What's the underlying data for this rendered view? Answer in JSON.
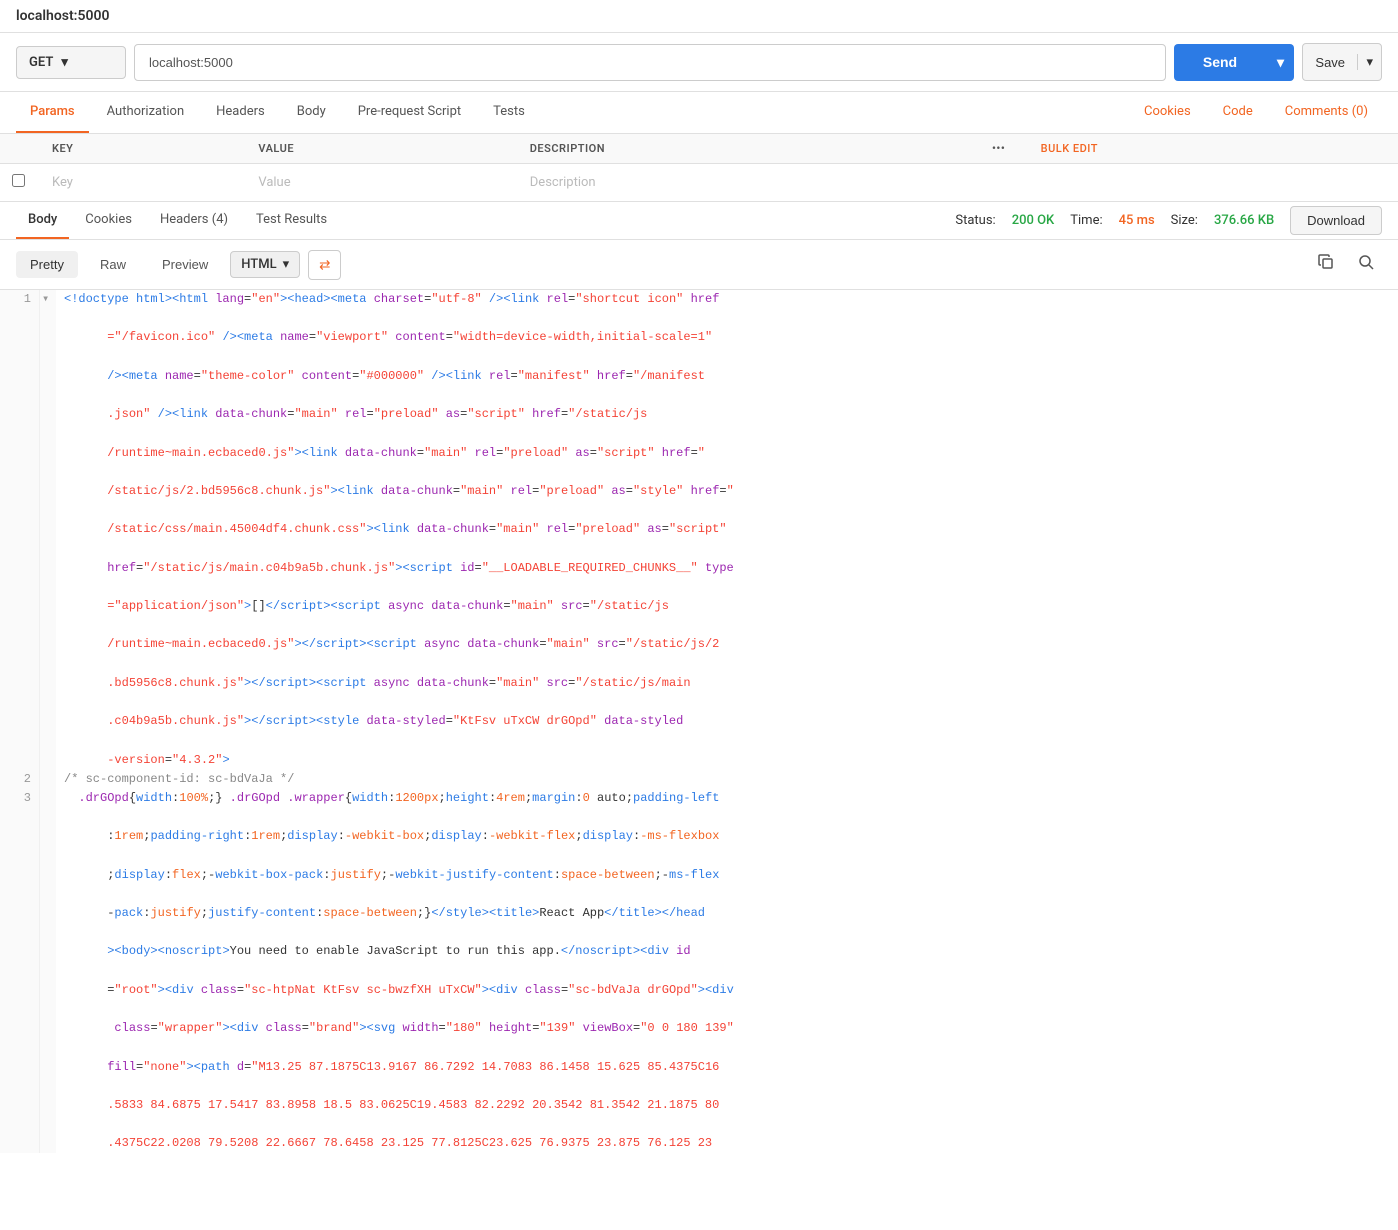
{
  "header": {
    "host": "localhost:5000"
  },
  "request": {
    "method": "GET",
    "url": "localhost:5000",
    "send_label": "Send",
    "save_label": "Save"
  },
  "request_tabs": [
    {
      "id": "params",
      "label": "Params",
      "active": true
    },
    {
      "id": "authorization",
      "label": "Authorization"
    },
    {
      "id": "headers",
      "label": "Headers"
    },
    {
      "id": "body",
      "label": "Body"
    },
    {
      "id": "pre-request-script",
      "label": "Pre-request Script"
    },
    {
      "id": "tests",
      "label": "Tests"
    },
    {
      "id": "cookies",
      "label": "Cookies",
      "style": "orange"
    },
    {
      "id": "code",
      "label": "Code",
      "style": "orange"
    },
    {
      "id": "comments",
      "label": "Comments (0)",
      "style": "orange"
    }
  ],
  "params_table": {
    "columns": [
      "KEY",
      "VALUE",
      "DESCRIPTION"
    ],
    "rows": [
      {
        "key": "Key",
        "value": "Value",
        "description": "Description"
      }
    ],
    "more_label": "...",
    "bulk_edit_label": "Bulk Edit"
  },
  "response_tabs": [
    {
      "id": "body",
      "label": "Body",
      "active": true
    },
    {
      "id": "cookies",
      "label": "Cookies"
    },
    {
      "id": "headers",
      "label": "Headers (4)"
    },
    {
      "id": "test-results",
      "label": "Test Results"
    }
  ],
  "response_status": {
    "status_label": "Status:",
    "status_value": "200 OK",
    "time_label": "Time:",
    "time_value": "45 ms",
    "size_label": "Size:",
    "size_value": "376.66 KB",
    "download_label": "Download"
  },
  "format_row": {
    "views": [
      "Pretty",
      "Raw",
      "Preview"
    ],
    "active_view": "Pretty",
    "format": "HTML",
    "wrap_icon": "≡→"
  },
  "code_content": {
    "lines": [
      {
        "num": "1",
        "arrow": "▾",
        "html": "<span class='c-tag'>&lt;!doctype html&gt;&lt;html </span><span class='c-attr'>lang</span><span class='c-txt'>=</span><span class='c-val'>\"en\"</span><span class='c-tag'>&gt;&lt;head&gt;&lt;meta </span><span class='c-attr'>charset</span><span class='c-txt'>=</span><span class='c-val'>\"utf-8\"</span><span class='c-tag'> /&gt;&lt;link </span><span class='c-attr'>rel</span><span class='c-txt'>=</span><span class='c-val'>\"shortcut icon\"</span><span class='c-attr'> href</span><br>&nbsp;&nbsp;&nbsp;&nbsp;&nbsp;&nbsp;&nbsp;<span class='c-val'>=\"/favicon.ico\"</span><span class='c-tag'> /&gt;&lt;meta </span><span class='c-attr'>name</span><span class='c-txt'>=</span><span class='c-val'>\"viewport\"</span><span class='c-attr'> content</span><span class='c-txt'>=</span><span class='c-val'>\"width=device-width,initial-scale=1\"</span><br>&nbsp;&nbsp;&nbsp;&nbsp;&nbsp;&nbsp;&nbsp;<span class='c-tag'>/&gt;&lt;meta </span><span class='c-attr'>name</span><span class='c-txt'>=</span><span class='c-val'>\"theme-color\"</span><span class='c-attr'> content</span><span class='c-txt'>=</span><span class='c-val'>\"#000000\"</span><span class='c-tag'> /&gt;&lt;link </span><span class='c-attr'>rel</span><span class='c-txt'>=</span><span class='c-val'>\"manifest\"</span><span class='c-attr'> href</span><span class='c-txt'>=</span><span class='c-val'>\"/manifest</span><br>&nbsp;&nbsp;&nbsp;&nbsp;&nbsp;&nbsp;&nbsp;<span class='c-val'>.json\"</span><span class='c-tag'> /&gt;&lt;link </span><span class='c-attr'>data-chunk</span><span class='c-txt'>=</span><span class='c-val'>\"main\"</span><span class='c-attr'> rel</span><span class='c-txt'>=</span><span class='c-val'>\"preload\"</span><span class='c-attr'> as</span><span class='c-txt'>=</span><span class='c-val'>\"script\"</span><span class='c-attr'> href</span><span class='c-txt'>=</span><span class='c-val'>\"/static/js</span><br>&nbsp;&nbsp;&nbsp;&nbsp;&nbsp;&nbsp;&nbsp;<span class='c-val'>/runtime~main.ecbaced0.js\"</span><span class='c-tag'>&gt;&lt;link </span><span class='c-attr'>data-chunk</span><span class='c-txt'>=</span><span class='c-val'>\"main\"</span><span class='c-attr'> rel</span><span class='c-txt'>=</span><span class='c-val'>\"preload\"</span><span class='c-attr'> as</span><span class='c-txt'>=</span><span class='c-val'>\"script\"</span><span class='c-attr'> href</span><span class='c-txt'>=</span><span class='c-val'>\"</span><br>&nbsp;&nbsp;&nbsp;&nbsp;&nbsp;&nbsp;&nbsp;<span class='c-val'>/static/js/2.bd5956c8.chunk.js\"</span><span class='c-tag'>&gt;&lt;link </span><span class='c-attr'>data-chunk</span><span class='c-txt'>=</span><span class='c-val'>\"main\"</span><span class='c-attr'> rel</span><span class='c-txt'>=</span><span class='c-val'>\"preload\"</span><span class='c-attr'> as</span><span class='c-txt'>=</span><span class='c-val'>\"style\"</span><span class='c-attr'> href</span><span class='c-txt'>=</span><span class='c-val'>\"</span><br>&nbsp;&nbsp;&nbsp;&nbsp;&nbsp;&nbsp;&nbsp;<span class='c-val'>/static/css/main.45004df4.chunk.css\"</span><span class='c-tag'>&gt;&lt;link </span><span class='c-attr'>data-chunk</span><span class='c-txt'>=</span><span class='c-val'>\"main\"</span><span class='c-attr'> rel</span><span class='c-txt'>=</span><span class='c-val'>\"preload\"</span><span class='c-attr'> as</span><span class='c-txt'>=</span><span class='c-val'>\"script\"</span><br>&nbsp;&nbsp;&nbsp;&nbsp;&nbsp;&nbsp;&nbsp;<span class='c-attr'>href</span><span class='c-txt'>=</span><span class='c-val'>\"/static/js/main.c04b9a5b.chunk.js\"</span><span class='c-tag'>&gt;&lt;script </span><span class='c-attr'>id</span><span class='c-txt'>=</span><span class='c-val'>\"__LOADABLE_REQUIRED_CHUNKS__\"</span><span class='c-attr'> type</span><br>&nbsp;&nbsp;&nbsp;&nbsp;&nbsp;&nbsp;&nbsp;<span class='c-val'>=\"application/json\"</span><span class='c-tag'>&gt;</span><span class='c-txt'>[]</span><span class='c-tag'>&lt;/script&gt;&lt;script </span><span class='c-attr'>async</span><span class='c-attr'> data-chunk</span><span class='c-txt'>=</span><span class='c-val'>\"main\"</span><span class='c-attr'> src</span><span class='c-txt'>=</span><span class='c-val'>\"/static/js</span><br>&nbsp;&nbsp;&nbsp;&nbsp;&nbsp;&nbsp;&nbsp;<span class='c-val'>/runtime~main.ecbaced0.js\"</span><span class='c-tag'>&gt;&lt;/script&gt;&lt;script </span><span class='c-attr'>async</span><span class='c-attr'> data-chunk</span><span class='c-txt'>=</span><span class='c-val'>\"main\"</span><span class='c-attr'> src</span><span class='c-txt'>=</span><span class='c-val'>\"/static/js/2</span><br>&nbsp;&nbsp;&nbsp;&nbsp;&nbsp;&nbsp;&nbsp;<span class='c-val'>.bd5956c8.chunk.js\"</span><span class='c-tag'>&gt;&lt;/script&gt;&lt;script </span><span class='c-attr'>async</span><span class='c-attr'> data-chunk</span><span class='c-txt'>=</span><span class='c-val'>\"main\"</span><span class='c-attr'> src</span><span class='c-txt'>=</span><span class='c-val'>\"/static/js/main</span><br>&nbsp;&nbsp;&nbsp;&nbsp;&nbsp;&nbsp;&nbsp;<span class='c-val'>.c04b9a5b.chunk.js\"</span><span class='c-tag'>&gt;&lt;/script&gt;&lt;style </span><span class='c-attr'>data-styled</span><span class='c-txt'>=</span><span class='c-val'>\"KtFsv uTxCW drGOpd\"</span><span class='c-attr'> data-styled</span><br>&nbsp;&nbsp;&nbsp;&nbsp;&nbsp;&nbsp;&nbsp;<span class='c-val'>-version</span><span class='c-txt'>=</span><span class='c-val'>\"4.3.2\"</span><span class='c-tag'>&gt;</span>"
      },
      {
        "num": "2",
        "arrow": "",
        "html": "<span class='c-comment'>/* sc-component-id: sc-bdVaJa */</span>"
      },
      {
        "num": "3",
        "arrow": "",
        "html": "&nbsp;&nbsp;<span class='c-sel'>.drGOpd</span><span class='c-txt'>{</span><span class='c-prop'>width</span><span class='c-txt'>:</span><span class='c-orange'>100%</span><span class='c-txt'>;}</span> <span class='c-sel'>.drGOpd .wrapper</span><span class='c-txt'>{</span><span class='c-prop'>width</span><span class='c-txt'>:</span><span class='c-orange'>1200px</span><span class='c-txt'>;</span><span class='c-prop'>height</span><span class='c-txt'>:</span><span class='c-orange'>4rem</span><span class='c-txt'>;</span><span class='c-prop'>margin</span><span class='c-txt'>:</span><span class='c-orange'>0</span> auto<span class='c-txt'>;</span><span class='c-prop'>padding-left</span><br>&nbsp;&nbsp;&nbsp;&nbsp;&nbsp;&nbsp;&nbsp;<span class='c-txt'>:</span><span class='c-orange'>1rem</span><span class='c-txt'>;</span><span class='c-prop'>padding-right</span><span class='c-txt'>:</span><span class='c-orange'>1rem</span><span class='c-txt'>;</span><span class='c-prop'>display</span><span class='c-txt'>:</span><span class='c-orange'>-webkit-box</span><span class='c-txt'>;</span><span class='c-prop'>display</span><span class='c-txt'>:</span><span class='c-orange'>-webkit-flex</span><span class='c-txt'>;</span><span class='c-prop'>display</span><span class='c-txt'>:</span><span class='c-orange'>-ms-flexbox</span><br>&nbsp;&nbsp;&nbsp;&nbsp;&nbsp;&nbsp;&nbsp;<span class='c-txt'>;</span><span class='c-prop'>display</span><span class='c-txt'>:</span><span class='c-orange'>flex</span><span class='c-txt'>;-</span><span class='c-prop'>webkit-box-pack</span><span class='c-txt'>:</span><span class='c-orange'>justify</span><span class='c-txt'>;-</span><span class='c-prop'>webkit-justify-content</span><span class='c-txt'>:</span><span class='c-orange'>space-between</span><span class='c-txt'>;-</span><span class='c-prop'>ms-flex</span><br>&nbsp;&nbsp;&nbsp;&nbsp;&nbsp;&nbsp;&nbsp;<span class='c-txt'>-</span><span class='c-prop'>pack</span><span class='c-txt'>:</span><span class='c-orange'>justify</span><span class='c-txt'>;</span><span class='c-prop'>justify-content</span><span class='c-txt'>:</span><span class='c-orange'>space-between</span><span class='c-txt'>;}</span><span class='c-tag'>&lt;/style&gt;&lt;title&gt;</span><span class='c-txt'>React App</span><span class='c-tag'>&lt;/title&gt;&lt;/head</span><br>&nbsp;&nbsp;&nbsp;&nbsp;&nbsp;&nbsp;&nbsp;<span class='c-tag'>&gt;&lt;body&gt;&lt;noscript&gt;</span><span class='c-txt'>You need to enable JavaScript to run this app.</span><span class='c-tag'>&lt;/noscript&gt;&lt;div </span><span class='c-attr'>id</span><br>&nbsp;&nbsp;&nbsp;&nbsp;&nbsp;&nbsp;&nbsp;<span class='c-txt'>=</span><span class='c-val'>\"root\"</span><span class='c-tag'>&gt;&lt;div </span><span class='c-attr'>class</span><span class='c-txt'>=</span><span class='c-val'>\"sc-htpNat KtFsv sc-bwzfXH uTxCW\"</span><span class='c-tag'>&gt;&lt;div </span><span class='c-attr'>class</span><span class='c-txt'>=</span><span class='c-val'>\"sc-bdVaJa drGOpd\"</span><span class='c-tag'>&gt;&lt;div</span><br>&nbsp;&nbsp;&nbsp;&nbsp;&nbsp;&nbsp;&nbsp;<span class='c-attr'> class</span><span class='c-txt'>=</span><span class='c-val'>\"wrapper\"</span><span class='c-tag'>&gt;&lt;div </span><span class='c-attr'>class</span><span class='c-txt'>=</span><span class='c-val'>\"brand\"</span><span class='c-tag'>&gt;&lt;svg </span><span class='c-attr'>width</span><span class='c-txt'>=</span><span class='c-val'>\"180\"</span><span class='c-attr'> height</span><span class='c-txt'>=</span><span class='c-val'>\"139\"</span><span class='c-attr'> viewBox</span><span class='c-txt'>=</span><span class='c-val'>\"0 0 180 139\"</span><br>&nbsp;&nbsp;&nbsp;&nbsp;&nbsp;&nbsp;&nbsp;<span class='c-attr'>fill</span><span class='c-txt'>=</span><span class='c-val'>\"none\"</span><span class='c-tag'>&gt;&lt;path </span><span class='c-attr'>d</span><span class='c-txt'>=</span><span class='c-val'>\"M13.25 87.1875C13.9167 86.7292 14.7083 86.1458 15.625 85.4375C16</span><br>&nbsp;&nbsp;&nbsp;&nbsp;&nbsp;&nbsp;&nbsp;<span class='c-val'>.5833 84.6875 17.5417 83.8958 18.5 83.0625C19.4583 82.2292 20.3542 81.3542 21.1875 80</span><br>&nbsp;&nbsp;&nbsp;&nbsp;&nbsp;&nbsp;&nbsp;<span class='c-val'>.4375C22.0208 79.5208 22.6667 78.6458 23.125 77.8125C23.625 76.9375 23.875 76.125 23</span>"
      }
    ]
  }
}
